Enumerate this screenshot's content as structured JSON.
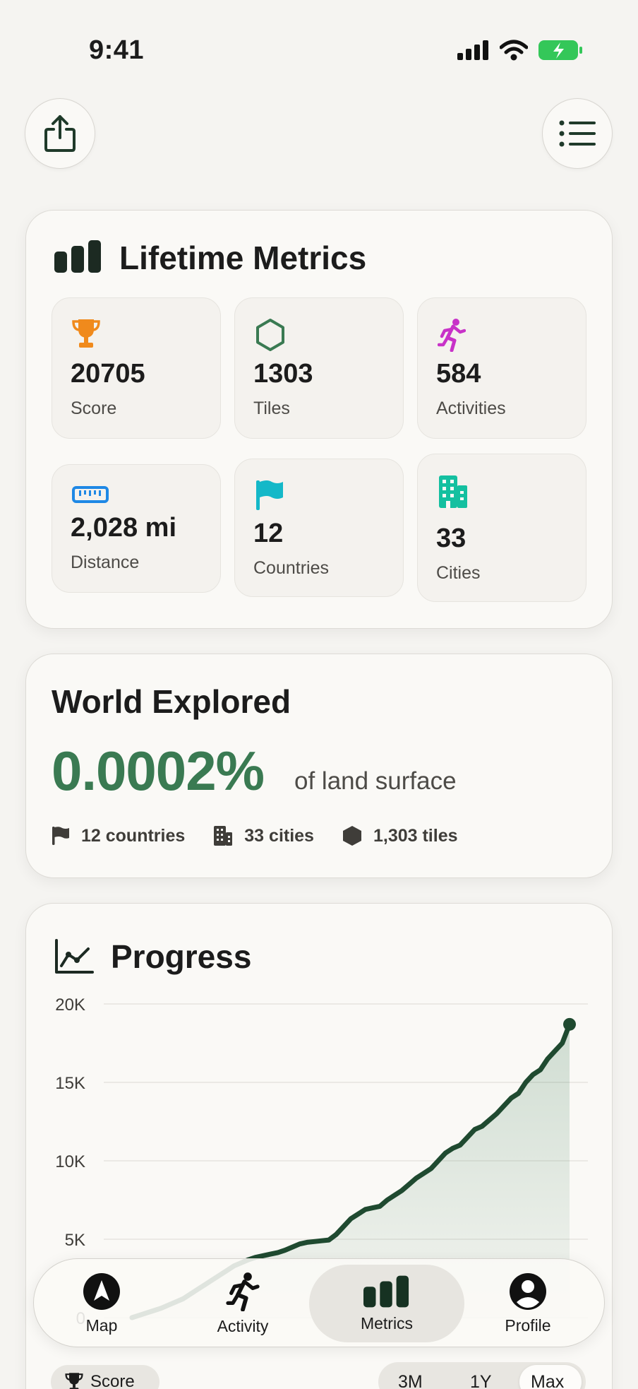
{
  "status_bar": {
    "time": "9:41"
  },
  "header": {
    "share_icon": "share-icon",
    "menu_icon": "list-icon"
  },
  "lifetime_metrics": {
    "title": "Lifetime Metrics",
    "tiles": [
      {
        "value": "20705",
        "label": "Score",
        "icon": "trophy-icon",
        "color": "#f08a1c"
      },
      {
        "value": "1303",
        "label": "Tiles",
        "icon": "hexagon-icon",
        "color": "#3a7a52"
      },
      {
        "value": "584",
        "label": "Activities",
        "icon": "runner-icon",
        "color": "#c832c8"
      },
      {
        "value": "2,028 mi",
        "label": "Distance",
        "icon": "ruler-icon",
        "color": "#1e88e5"
      },
      {
        "value": "12",
        "label": "Countries",
        "icon": "flag-icon",
        "color": "#14b8c8"
      },
      {
        "value": "33",
        "label": "Cities",
        "icon": "building-icon",
        "color": "#14c0a0"
      }
    ]
  },
  "world_explored": {
    "title": "World Explored",
    "percent": "0.0002%",
    "suffix": "of land surface",
    "stats": [
      {
        "icon": "flag-icon",
        "text": "12 countries"
      },
      {
        "icon": "building-icon",
        "text": "33 cities"
      },
      {
        "icon": "hexagon-icon",
        "text": "1,303 tiles"
      }
    ]
  },
  "progress": {
    "title": "Progress",
    "score_chip": "Score",
    "ranges": [
      "3M",
      "1Y",
      "Max"
    ],
    "selected_range": "Max"
  },
  "chart_data": {
    "type": "area",
    "ylim": [
      0,
      20000
    ],
    "y_ticks": [
      "20K",
      "15K",
      "10K",
      "5K",
      "0"
    ],
    "x": [
      0,
      1,
      2,
      3,
      4,
      5,
      6,
      7,
      8,
      9,
      10,
      11,
      12,
      13,
      14,
      15,
      16,
      17,
      18,
      19,
      20,
      21,
      22,
      23,
      24,
      25,
      26,
      27,
      28,
      29,
      30,
      31,
      32,
      33,
      34,
      35,
      36,
      37,
      38,
      39,
      40,
      41,
      42,
      43,
      44,
      45,
      46,
      47,
      48,
      49,
      50,
      51,
      52,
      53,
      54,
      55,
      56,
      57,
      58,
      59,
      60
    ],
    "series": [
      {
        "values": [
          0,
          150,
          300,
          450,
          600,
          800,
          1000,
          1200,
          1500,
          1800,
          2100,
          2400,
          2700,
          3000,
          3300,
          3500,
          3700,
          3850,
          3950,
          4050,
          4150,
          4300,
          4500,
          4700,
          4800,
          4850,
          4900,
          4950,
          5300,
          5800,
          6300,
          6600,
          6900,
          7000,
          7100,
          7500,
          7800,
          8100,
          8500,
          8900,
          9200,
          9500,
          10000,
          10500,
          10800,
          11000,
          11500,
          12000,
          12200,
          12600,
          13000,
          13500,
          14000,
          14300,
          15000,
          15500,
          15800,
          16500,
          17000,
          17500,
          18700
        ]
      }
    ],
    "color": "#1f4a30"
  },
  "tabbar": {
    "tabs": [
      {
        "label": "Map",
        "icon": "navigation-arrow-icon"
      },
      {
        "label": "Activity",
        "icon": "runner-icon"
      },
      {
        "label": "Metrics",
        "icon": "bar-chart-icon"
      },
      {
        "label": "Profile",
        "icon": "person-circle-icon"
      }
    ],
    "active": "Metrics"
  }
}
